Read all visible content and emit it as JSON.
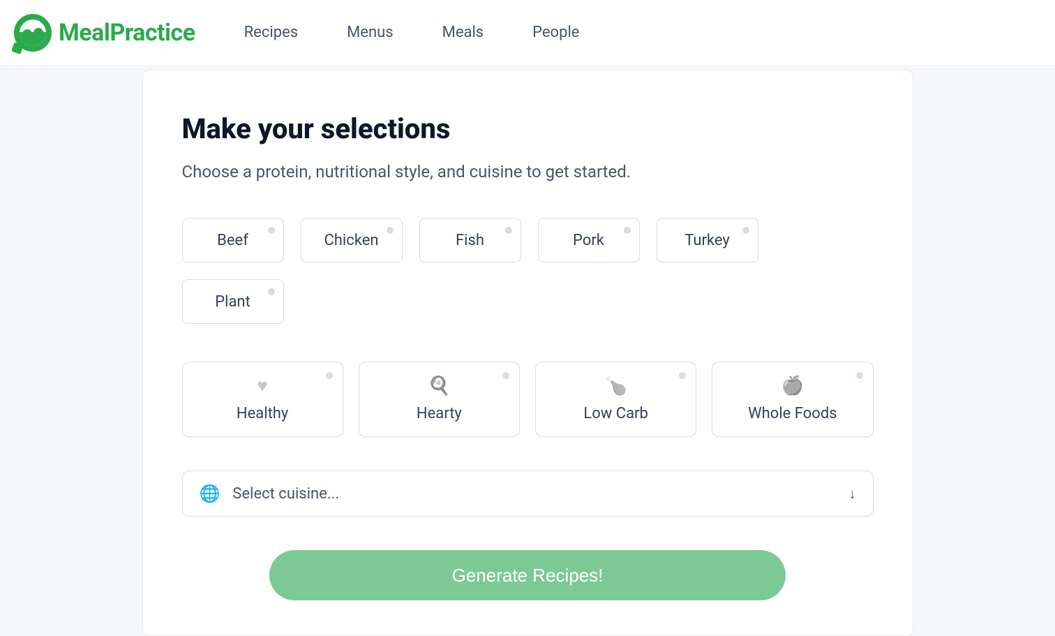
{
  "brand": {
    "name": "MealPractice"
  },
  "nav": {
    "items": [
      {
        "label": "Recipes"
      },
      {
        "label": "Menus"
      },
      {
        "label": "Meals"
      },
      {
        "label": "People"
      }
    ]
  },
  "page": {
    "title": "Make your selections",
    "subtitle": "Choose a protein, nutritional style, and cuisine to get started."
  },
  "proteins": {
    "items": [
      {
        "label": "Beef"
      },
      {
        "label": "Chicken"
      },
      {
        "label": "Fish"
      },
      {
        "label": "Pork"
      },
      {
        "label": "Turkey"
      },
      {
        "label": "Plant"
      }
    ]
  },
  "styles": {
    "items": [
      {
        "label": "Healthy",
        "icon": "heart-icon",
        "glyph": "♥"
      },
      {
        "label": "Hearty",
        "icon": "stove-icon",
        "glyph": "🍳"
      },
      {
        "label": "Low Carb",
        "icon": "poultry-icon",
        "glyph": "🍗"
      },
      {
        "label": "Whole Foods",
        "icon": "apple-icon",
        "glyph": "🍎"
      }
    ]
  },
  "cuisine": {
    "placeholder": "Select cuisine...",
    "icon": "globe-icon"
  },
  "cta": {
    "label": "Generate Recipes!"
  },
  "colors": {
    "brand_green": "#29ab4b",
    "cta_green": "#7dc995",
    "text_dark": "#0f172a",
    "text_muted": "#475569",
    "border": "#d6dde7",
    "bg": "#f5f8fb"
  }
}
